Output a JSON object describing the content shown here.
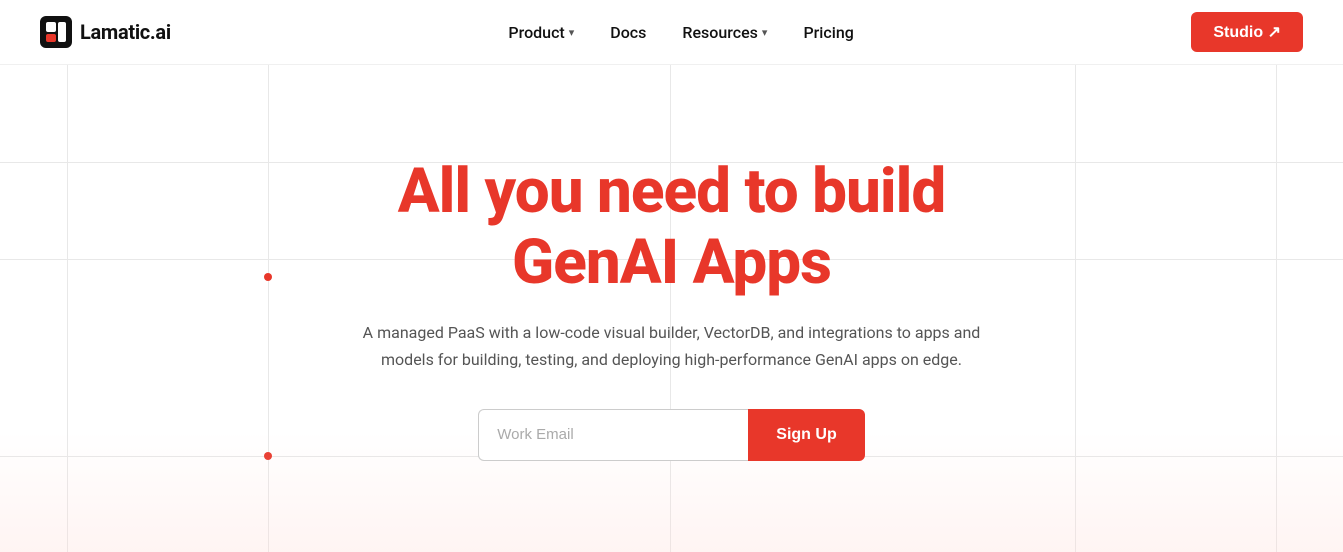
{
  "navbar": {
    "logo_text": "Lamatic.ai",
    "nav_items": [
      {
        "label": "Product",
        "has_dropdown": true
      },
      {
        "label": "Docs",
        "has_dropdown": false
      },
      {
        "label": "Resources",
        "has_dropdown": true
      },
      {
        "label": "Pricing",
        "has_dropdown": false
      }
    ],
    "studio_label": "Studio ↗"
  },
  "hero": {
    "title_line1": "All you need to build",
    "title_line2": "GenAI Apps",
    "subtitle": "A managed PaaS with a low-code visual builder, VectorDB, and integrations to apps and models for building, testing, and deploying high-performance GenAI apps on edge.",
    "email_placeholder": "Work Email",
    "signup_label": "Sign Up"
  },
  "colors": {
    "accent": "#e8372a",
    "text_dark": "#111111",
    "text_muted": "#555555",
    "border": "#cccccc",
    "grid_line": "#e8e8e8"
  }
}
